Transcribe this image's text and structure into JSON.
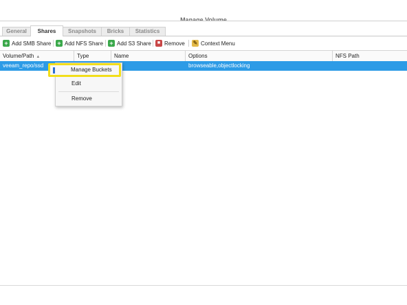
{
  "window": {
    "title": "Manage Volume"
  },
  "tabs": [
    {
      "label": "General",
      "active": false
    },
    {
      "label": "Shares",
      "active": true
    },
    {
      "label": "Snapshots",
      "active": false
    },
    {
      "label": "Bricks",
      "active": false
    },
    {
      "label": "Statistics",
      "active": false
    }
  ],
  "toolbar": {
    "add_smb": "Add SMB Share",
    "add_nfs": "Add NFS Share",
    "add_s3": "Add S3 Share",
    "remove": "Remove",
    "context_menu": "Context Menu",
    "plus_glyph": "+",
    "remove_glyph": "■",
    "context_glyph": "✎"
  },
  "table": {
    "columns": [
      "Volume/Path",
      "Type",
      "Name",
      "Options",
      "NFS Path"
    ],
    "sort_indicator": "▲",
    "rows": [
      {
        "volume_path": "veeam_repo/ssd",
        "type": "",
        "name": "",
        "options": "browseable,objectlocking",
        "nfs_path": ""
      }
    ]
  },
  "context_menu": {
    "items": [
      "Manage Buckets",
      "Edit",
      "Remove"
    ],
    "highlighted": "Manage Buckets"
  },
  "colors": {
    "selection": "#2d9be6",
    "highlight_border": "#f2de1a",
    "add_icon": "#3aa84a",
    "remove_icon": "#c84646",
    "context_icon": "#e3b948"
  }
}
